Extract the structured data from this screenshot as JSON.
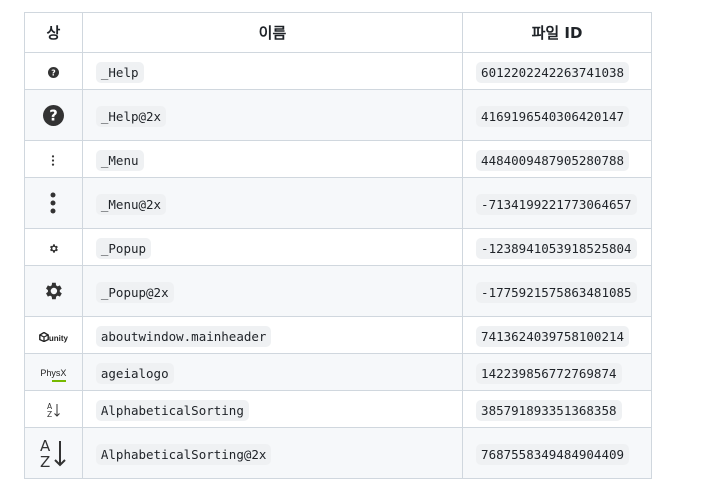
{
  "table": {
    "headers": [
      "상",
      "이름",
      "파일 ID"
    ],
    "rows": [
      {
        "icon": "help-icon-small",
        "name": "_Help",
        "id": "6012202242263741038"
      },
      {
        "icon": "help-icon-large",
        "name": "_Help@2x",
        "id": "4169196540306420147"
      },
      {
        "icon": "menu-dots-icon-small",
        "name": "_Menu",
        "id": "4484009487905280788"
      },
      {
        "icon": "menu-dots-icon-large",
        "name": "_Menu@2x",
        "id": "-7134199221773064657"
      },
      {
        "icon": "gear-icon-small",
        "name": "_Popup",
        "id": "-1238941053918525804"
      },
      {
        "icon": "gear-icon-large",
        "name": "_Popup@2x",
        "id": "-1775921575863481085"
      },
      {
        "icon": "unity-logo-icon",
        "name": "aboutwindow.mainheader",
        "id": "7413624039758100214"
      },
      {
        "icon": "physx-logo-icon",
        "name": "ageialogo",
        "id": "142239856772769874"
      },
      {
        "icon": "sort-az-icon-small",
        "name": "AlphabeticalSorting",
        "id": "385791893351368358"
      },
      {
        "icon": "sort-az-icon-large",
        "name": "AlphabeticalSorting@2x",
        "id": "7687558349484904409"
      }
    ]
  },
  "logos": {
    "unity": "unity",
    "physx": "PhysX"
  }
}
